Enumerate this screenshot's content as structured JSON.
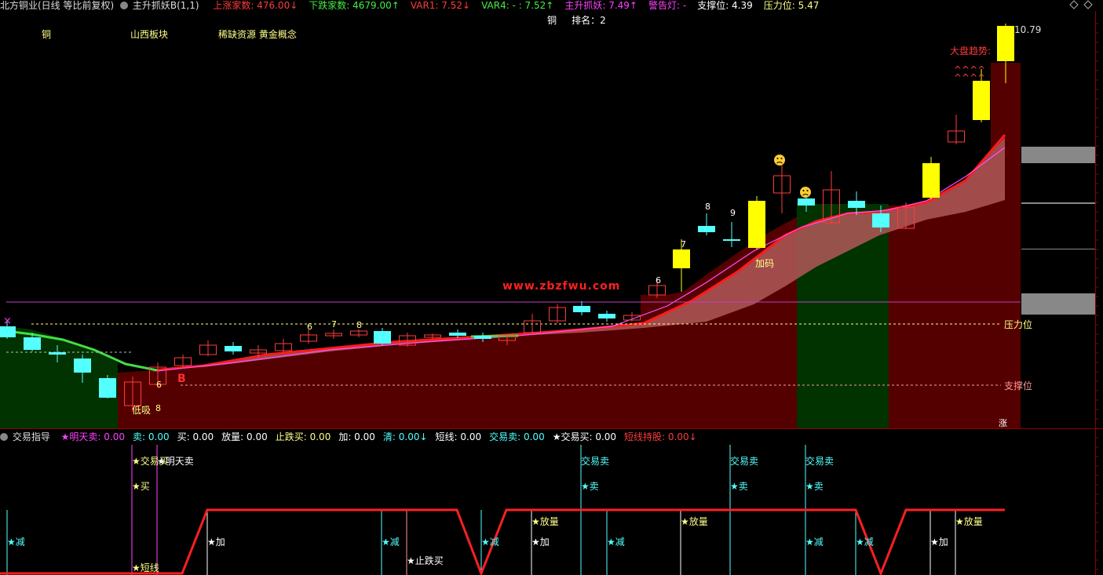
{
  "colors": {
    "up": "#ff3b3b",
    "down": "#54ffff",
    "yellow": "#ffff00",
    "magenta": "#ff40ff",
    "green": "#44dd44",
    "dark_red": "#550000",
    "dark_green": "#003300",
    "pale_yellow": "#ffff88",
    "white": "#ffffff"
  },
  "header": {
    "title": "北方铜业(日线 等比前复权)",
    "indicator_name": "主升抓妖B(1,1)",
    "items": [
      {
        "label": "上涨家数:",
        "value": "476.00",
        "arrow": "↓",
        "color": "#ff3b3b"
      },
      {
        "label": "下跌家数:",
        "value": "4679.00",
        "arrow": "↑",
        "color": "#44ee44"
      },
      {
        "label": "VAR1:",
        "value": "7.52",
        "arrow": "↓",
        "color": "#ff3b3b"
      },
      {
        "label": "VAR4:",
        "value": "- : 7.52",
        "arrow": "↑",
        "color": "#44ee44"
      },
      {
        "label": "主升抓妖:",
        "value": "7.49",
        "arrow": "↑",
        "color": "#ff40ff"
      },
      {
        "label": "警告灯:",
        "value": "-",
        "arrow": "",
        "color": "#ff40ff"
      },
      {
        "label": "支撑位:",
        "value": "4.39",
        "arrow": "",
        "color": "#ffffff"
      },
      {
        "label": "压力位:",
        "value": "5.47",
        "arrow": "",
        "color": "#ffff88"
      }
    ]
  },
  "chart_labels": {
    "sector_copper": "铜",
    "sector_shanxi": "山西板块",
    "sector_concept": "稀缺资源 黄金概念",
    "rank_label": "铜     排名：2",
    "price_high": "10.79",
    "market_trend": "大盘趋势:",
    "carets": "^^^^\n^^^^",
    "pressure": "压力位",
    "support": "支撑位",
    "watermark": "www.zbzfwu.com",
    "add_chip": "加码",
    "b_mark": "B",
    "low_label": "低吸",
    "zhang": "涨",
    "x_mark": "×",
    "counts": [
      "6",
      "8",
      "6",
      "7",
      "8",
      "6",
      "7",
      "8",
      "9"
    ]
  },
  "lower_panel": {
    "title": "交易指导",
    "items": [
      {
        "label": "★明天卖:",
        "value": "0.00",
        "color": "#ff40ff"
      },
      {
        "label": "卖:",
        "value": "0.00",
        "color": "#54ffff"
      },
      {
        "label": "买:",
        "value": "0.00",
        "color": "#ffffff"
      },
      {
        "label": "放量:",
        "value": "0.00",
        "color": "#ffffff"
      },
      {
        "label": "止跌买:",
        "value": "0.00",
        "color": "#ffff88"
      },
      {
        "label": "加:",
        "value": "0.00",
        "color": "#ffffff"
      },
      {
        "label": "清:",
        "value": "0.00↓",
        "color": "#54ffff"
      },
      {
        "label": "短线:",
        "value": "0.00",
        "color": "#ffffff"
      },
      {
        "label": "交易卖:",
        "value": "0.00",
        "color": "#54ffff"
      },
      {
        "label": "★交易买:",
        "value": "0.00",
        "color": "#ffffff"
      },
      {
        "label": "短线持股:",
        "value": "0.00↓",
        "color": "#ff3b3b"
      }
    ],
    "signals": {
      "jiaoyimai": "★交易买",
      "mingtianmai": "★明天卖",
      "mai_buy": "★买",
      "duanxian": "★短线",
      "jian": "★减",
      "jia": "★加",
      "zhidiemai": "★止跌买",
      "fangliang": "★放量",
      "jiaoyimai_sell": "交易卖",
      "mai_sell": "★卖"
    }
  }
}
